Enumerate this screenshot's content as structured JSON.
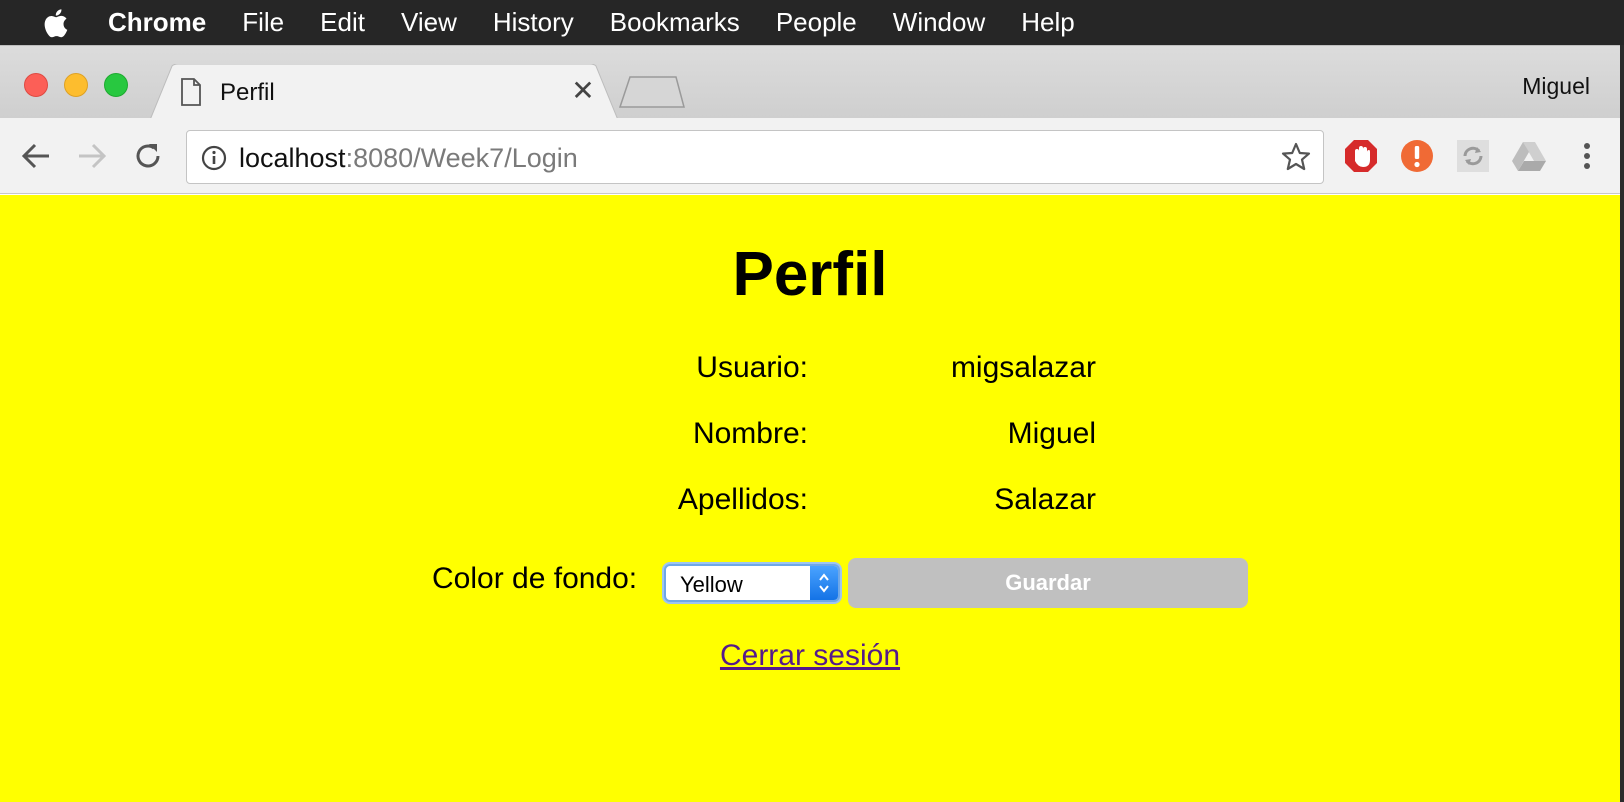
{
  "menubar": {
    "app_name": "Chrome",
    "items": [
      "File",
      "Edit",
      "View",
      "History",
      "Bookmarks",
      "People",
      "Window",
      "Help"
    ]
  },
  "browser": {
    "tab_title": "Perfil",
    "profile_name": "Miguel",
    "url_host": "localhost",
    "url_rest": ":8080/Week7/Login"
  },
  "page": {
    "heading": "Perfil",
    "fields": [
      {
        "label": "Usuario:",
        "value": "migsalazar"
      },
      {
        "label": "Nombre:",
        "value": "Miguel"
      },
      {
        "label": "Apellidos:",
        "value": "Salazar"
      }
    ],
    "color_label": "Color de fondo:",
    "color_selected": "Yellow",
    "save_label": "Guardar",
    "logout_label": "Cerrar sesión",
    "background_color": "#ffff00"
  }
}
